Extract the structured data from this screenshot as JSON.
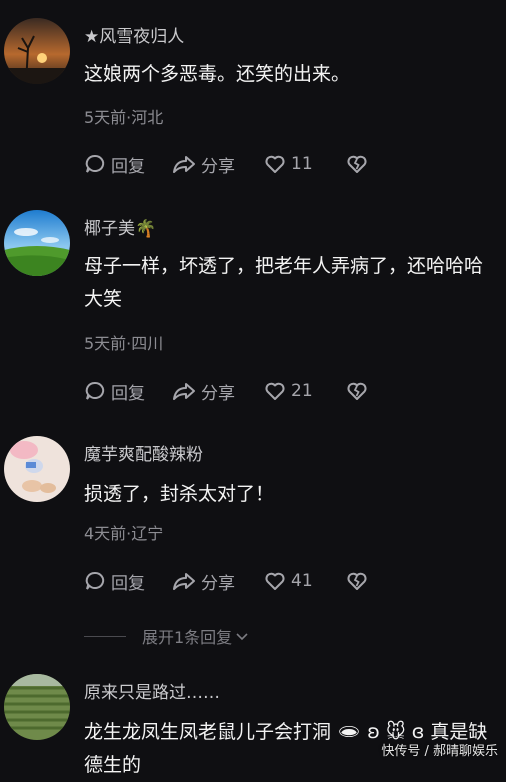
{
  "comments": [
    {
      "username": "★风雪夜归人",
      "content": "这娘两个多恶毒。还笑的出来。",
      "meta": "5天前·河北",
      "reply_label": "回复",
      "share_label": "分享",
      "likes": "11"
    },
    {
      "username": "椰子美🌴",
      "content": "母子一样，坏透了，把老年人弄病了，还哈哈哈大笑",
      "meta": "5天前·四川",
      "reply_label": "回复",
      "share_label": "分享",
      "likes": "21"
    },
    {
      "username": "魔芋爽配酸辣粉",
      "content": "损透了，封杀太对了！",
      "meta": "4天前·辽宁",
      "reply_label": "回复",
      "share_label": "分享",
      "likes": "41"
    },
    {
      "username": "原来只是路过……",
      "content": "龙生龙凤生凤老鼠儿子会打洞 🕳 ʚ 🐭 ɞ 真是缺德生的"
    }
  ],
  "expand_label": "展开1条回复",
  "watermark": "快传号 / 郝晴聊娱乐",
  "icons": [
    "reply-icon",
    "share-icon",
    "heart-icon",
    "broken-heart-icon",
    "chevron-down-icon"
  ],
  "colors": {
    "background": "#0f0f12",
    "secondary_text": "#8c8c92",
    "action_text": "#a6a6ac"
  }
}
